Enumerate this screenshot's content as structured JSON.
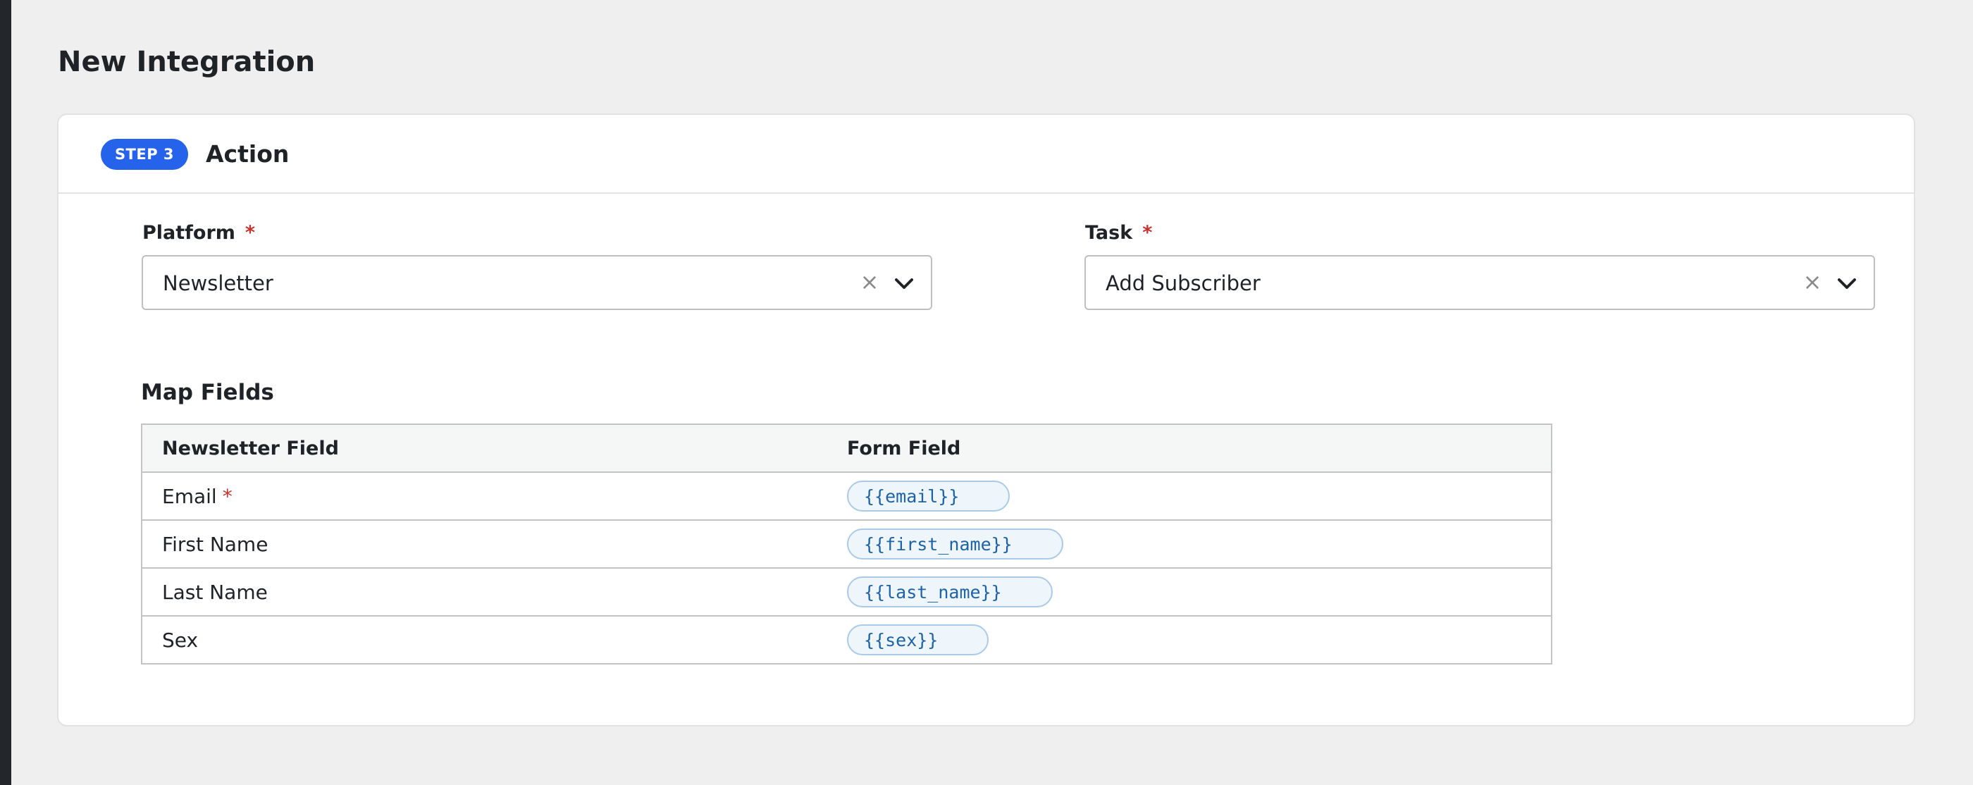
{
  "page": {
    "title": "New Integration"
  },
  "step": {
    "badge": "STEP 3",
    "title": "Action"
  },
  "platform": {
    "label": "Platform",
    "required": "*",
    "value": "Newsletter",
    "clear_symbol": "×",
    "dropdown_icon": "chevron-down-icon"
  },
  "task": {
    "label": "Task",
    "required": "*",
    "value": "Add Subscriber",
    "clear_symbol": "×",
    "dropdown_icon": "chevron-down-icon"
  },
  "map_fields": {
    "title": "Map Fields",
    "columns": [
      "Newsletter Field",
      "Form Field"
    ],
    "rows": [
      {
        "field": "Email",
        "required": "*",
        "token": "{{email}}"
      },
      {
        "field": "First Name",
        "required": "",
        "token": "{{first_name}}"
      },
      {
        "field": "Last Name",
        "required": "",
        "token": "{{last_name}}"
      },
      {
        "field": "Sex",
        "required": "",
        "token": "{{sex}}"
      }
    ]
  },
  "colors": {
    "accent": "#2563eb",
    "required": "#c9302c",
    "token_text": "#1d63a8",
    "token_bg": "#eef5fb",
    "page_bg": "#efefef"
  }
}
